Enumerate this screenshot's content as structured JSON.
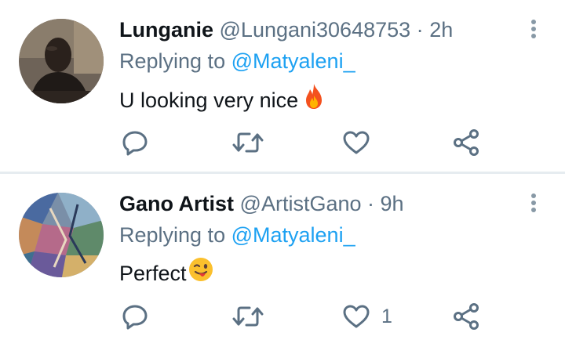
{
  "tweets": [
    {
      "name": "Lunganie",
      "handle": "@Lungani30648753",
      "separator": "·",
      "time": "2h",
      "replying_prefix": "Replying to",
      "replying_to": "@Matyaleni_",
      "text": "U looking very nice",
      "emoji": "fire",
      "like_count": ""
    },
    {
      "name": "Gano Artist",
      "handle": "@ArtistGano",
      "separator": "·",
      "time": "9h",
      "replying_prefix": "Replying to",
      "replying_to": "@Matyaleni_",
      "text": "Perfect",
      "emoji": "winking-face-with-tongue",
      "like_count": "1"
    }
  ],
  "colors": {
    "primary_text": "#0f1419",
    "secondary_text": "#5b7083",
    "link": "#1da1f2",
    "divider": "#e6ecf0"
  },
  "icons": [
    "more-vertical-icon",
    "reply-icon",
    "retweet-icon",
    "like-icon",
    "share-icon"
  ]
}
